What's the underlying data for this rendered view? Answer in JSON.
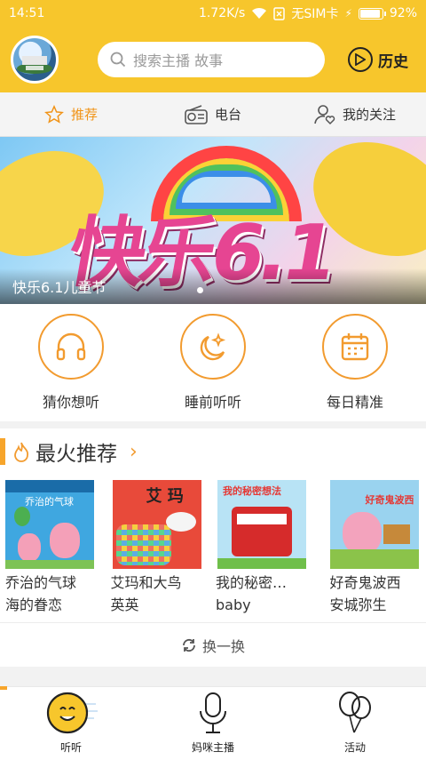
{
  "status_bar": {
    "time": "14:51",
    "speed": "1.72K/s",
    "carrier": "无SIM卡",
    "battery": "92%",
    "battery_level": 0.92
  },
  "header": {
    "search_placeholder": "搜索主播 故事",
    "history_label": "历史"
  },
  "tabs": [
    {
      "label": "推荐",
      "icon": "star-icon",
      "active": true
    },
    {
      "label": "电台",
      "icon": "radio-icon",
      "active": false
    },
    {
      "label": "我的关注",
      "icon": "user-heart-icon",
      "active": false
    }
  ],
  "banner": {
    "caption": "快乐6.1儿童节",
    "art_text": "快乐6.1",
    "page_index": 1
  },
  "quick_entries": [
    {
      "label": "猜你想听",
      "icon": "headphones-icon"
    },
    {
      "label": "睡前听听",
      "icon": "moon-star-icon"
    },
    {
      "label": "每日精准",
      "icon": "calendar-icon"
    }
  ],
  "section": {
    "title": "最火推荐",
    "icon": "flame-icon"
  },
  "books": [
    {
      "title_line1": "乔治的气球",
      "title_line2": "海的眷恋",
      "cover_text": "乔治的气球",
      "cover_color": "#3fa7e0"
    },
    {
      "title_line1": "艾玛和大鸟",
      "title_line2": "英英",
      "cover_text": "艾 玛",
      "cover_color": "#e84a3a"
    },
    {
      "title_line1": "我的秘密…",
      "title_line2": "baby",
      "cover_text": "我的秘密想法",
      "cover_color": "#6fbf4a"
    },
    {
      "title_line1": "好奇鬼波西",
      "title_line2": "安城弥生",
      "cover_text": "好奇鬼波西",
      "cover_color": "#9ad3ef"
    }
  ],
  "refresh_label": "换一换",
  "bottom_nav": [
    {
      "label": "听听",
      "icon": "smile-face-icon",
      "active": true
    },
    {
      "label": "妈咪主播",
      "icon": "microphone-icon",
      "active": false
    },
    {
      "label": "活动",
      "icon": "balloon-icon",
      "active": false
    }
  ],
  "colors": {
    "brand_yellow": "#f7c62c",
    "accent_orange": "#f29b2f"
  }
}
